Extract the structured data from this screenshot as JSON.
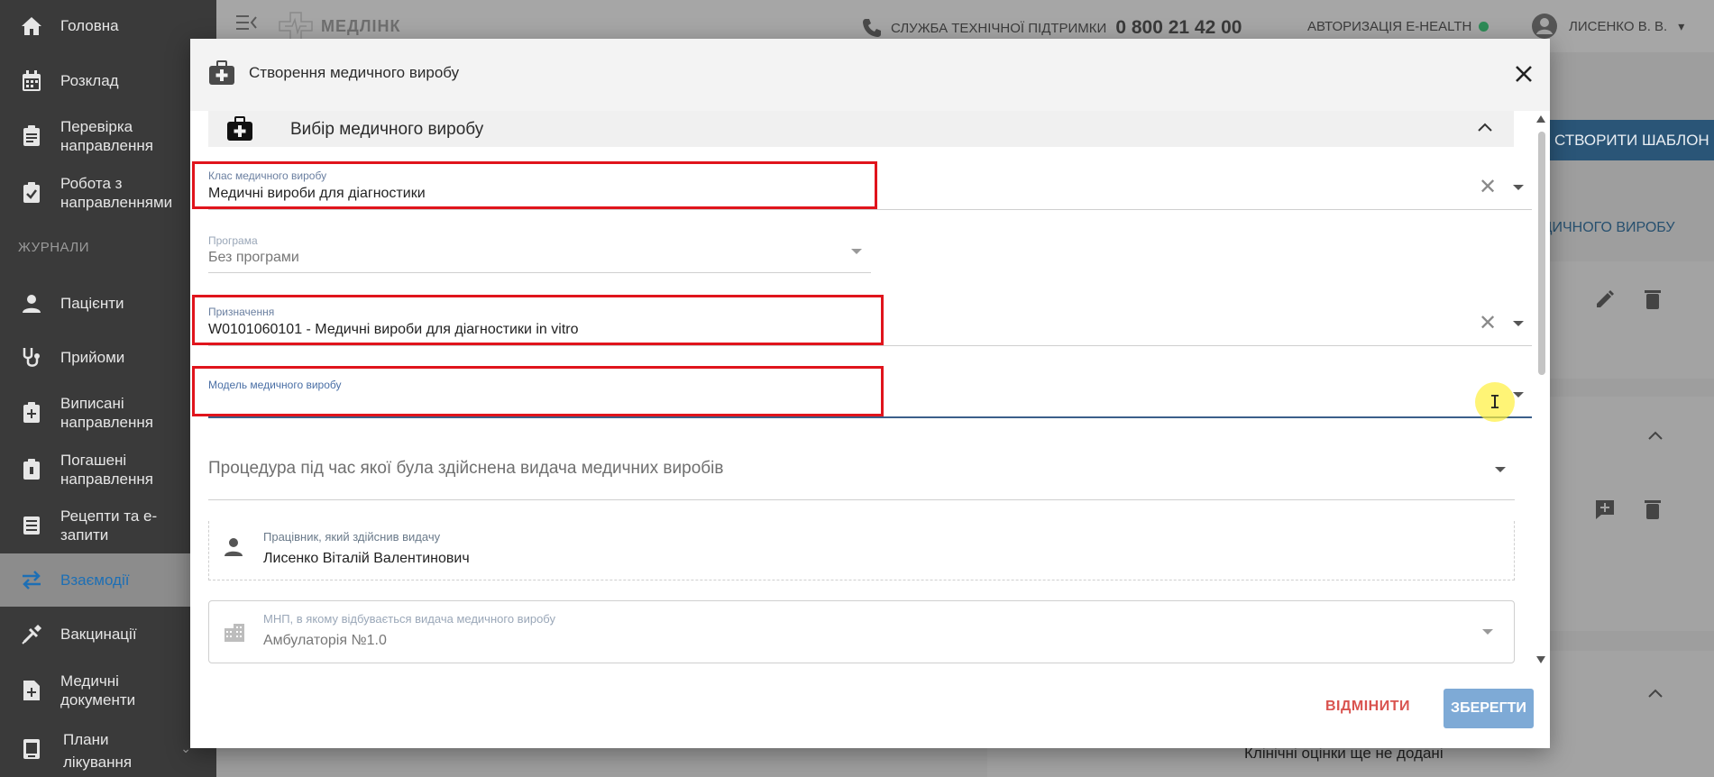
{
  "sidebar": {
    "items": [
      {
        "label": "Головна",
        "icon": "home-icon"
      },
      {
        "label": "Розклад",
        "icon": "calendar-icon"
      },
      {
        "label": "Перевірка\nнаправлення",
        "l1": "Перевірка",
        "l2": "направлення",
        "icon": "clipboard-icon"
      },
      {
        "label": "Робота з направленнями",
        "l1": "Робота з",
        "l2": "направленнями",
        "icon": "clipboard-check-icon"
      },
      {
        "label": "Пацієнти",
        "icon": "person-icon"
      },
      {
        "label": "Прийоми",
        "icon": "stethoscope-icon"
      },
      {
        "label": "Виписані направлення",
        "l1": "Виписані",
        "l2": "направлення",
        "icon": "clipboard-plus-icon"
      },
      {
        "label": "Погашені направлення",
        "l1": "Погашені",
        "l2": "направлення",
        "icon": "clipboard-x-icon"
      },
      {
        "label": "Рецепти та е-запити",
        "l1": "Рецепти та е-",
        "l2": "запити",
        "icon": "list-icon"
      },
      {
        "label": "Взаємодії",
        "icon": "swap-icon"
      },
      {
        "label": "Вакцинації",
        "icon": "syringe-icon"
      },
      {
        "label": "Медичні документи",
        "l1": "Медичні",
        "l2": "документи",
        "icon": "document-plus-icon"
      },
      {
        "label": "Плани лікування",
        "l1": "Плани",
        "l2": "лікування",
        "icon": "plan-icon"
      }
    ],
    "section_label": "ЖУРНАЛИ"
  },
  "topbar": {
    "logo_text": "МЕДЛІНК",
    "support_label": "СЛУЖБА ТЕХНІЧНОЇ ПІДТРИМКИ",
    "support_phone": "0 800 21 42 00",
    "auth_label": "АВТОРИЗАЦІЯ E-HEALTH",
    "auth_status_color": "#2e8b57",
    "user_name": "ЛИСЕНКО В. В."
  },
  "background": {
    "create_template_button": "СТВОРИТИ ШАБЛОН",
    "tab_label": "ЕДИЧНОГО ВИРОБУ",
    "empty_note": "Клінічні оцінки ще не додані"
  },
  "modal": {
    "title": "Створення медичного виробу",
    "section_title": "Вибір медичного виробу",
    "fields": {
      "device_class": {
        "label": "Клас медичного виробу",
        "value": "Медичні вироби для діагностики"
      },
      "program": {
        "label": "Програма",
        "value": "Без програми"
      },
      "purpose": {
        "label": "Призначення",
        "value": "W0101060101 - Медичні вироби для діагностики in vitro"
      },
      "model": {
        "label": "Модель медичного виробу",
        "value": ""
      },
      "procedure": {
        "placeholder": "Процедура під час якої була здійснена видача медичних виробів"
      },
      "worker": {
        "label": "Працівник, який здійснив видачу",
        "value": "Лисенко Віталій Валентинович"
      },
      "mnp": {
        "label": "МНП, в якому відбувається видача медичного виробу",
        "value": "Амбулаторія №1.0"
      }
    },
    "cancel_label": "ВІДМІНИТИ",
    "save_label": "ЗБЕРЕГТИ"
  },
  "colors": {
    "accent": "#1d6fb5",
    "highlight_box": "#e0141c",
    "save_button": "#7eaad6",
    "cancel_text": "#d9534f"
  }
}
